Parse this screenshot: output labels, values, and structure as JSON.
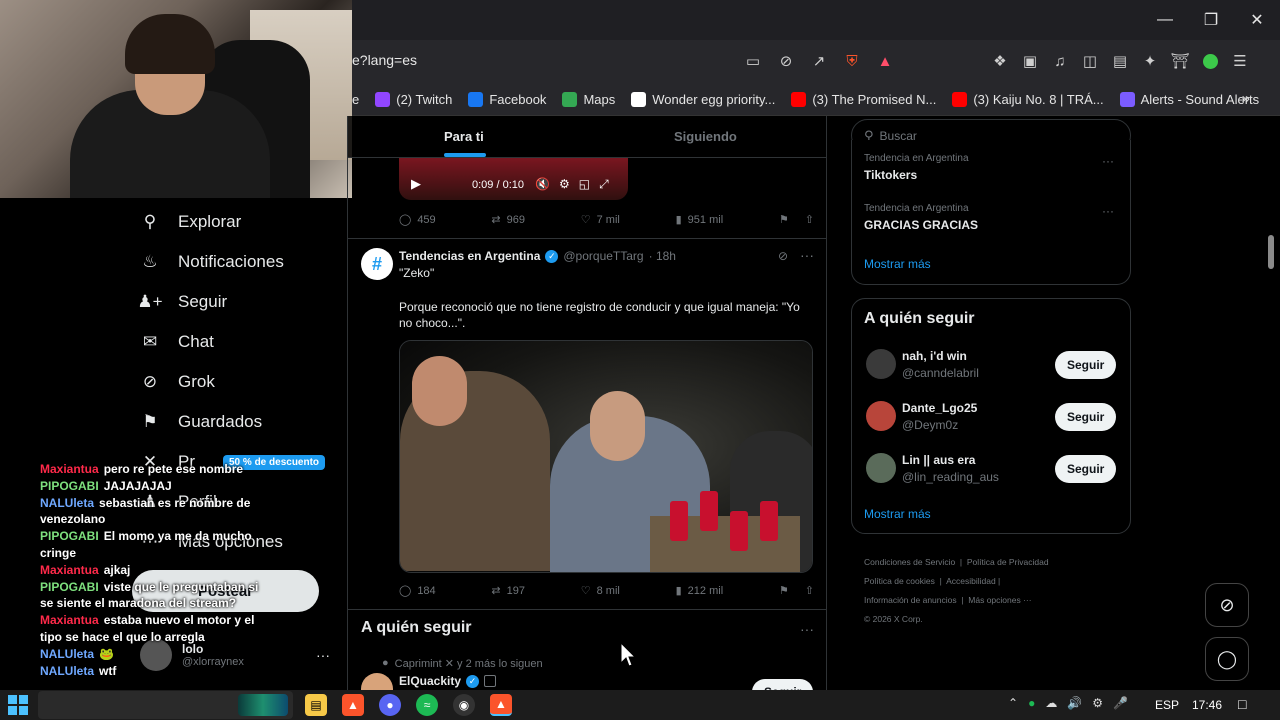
{
  "browser": {
    "url": "e?lang=es",
    "bookmarks": [
      {
        "label": "e",
        "icon": "partial-icon",
        "color": "#888888"
      },
      {
        "label": "(2) Twitch",
        "icon": "twitch-icon",
        "color": "#9146ff"
      },
      {
        "label": "Facebook",
        "icon": "facebook-icon",
        "color": "#1877f2"
      },
      {
        "label": "Maps",
        "icon": "maps-icon",
        "color": "#34a853"
      },
      {
        "label": "Wonder egg priority...",
        "icon": "google-icon",
        "color": "#ffffff"
      },
      {
        "label": "(3) The Promised N...",
        "icon": "youtube-icon",
        "color": "#ff0000"
      },
      {
        "label": "(3) Kaiju No. 8 | TRÁ...",
        "icon": "youtube-icon",
        "color": "#ff0000"
      },
      {
        "label": "Alerts - Sound Alerts",
        "icon": "soundalerts-icon",
        "color": "#7b5cff"
      }
    ]
  },
  "nav": {
    "items": [
      {
        "label": "Explorar",
        "icon": "search-icon"
      },
      {
        "label": "Notificaciones",
        "icon": "bell-icon"
      },
      {
        "label": "Seguir",
        "icon": "person-add-icon"
      },
      {
        "label": "Chat",
        "icon": "mail-icon"
      },
      {
        "label": "Grok",
        "icon": "grok-icon"
      },
      {
        "label": "Guardados",
        "icon": "bookmark-icon"
      },
      {
        "label": "Pr",
        "icon": "x-icon"
      },
      {
        "label": "Perfil",
        "icon": "person-icon"
      },
      {
        "label": "Más opciones",
        "icon": "more-icon"
      }
    ],
    "premium_badge": "50 % de descuento",
    "post_button": "Postear",
    "account_name": "lolo",
    "account_handle": "@xlorraynex"
  },
  "feed": {
    "tabs": [
      "Para ti",
      "Siguiendo"
    ],
    "video_time": "0:09 / 0:10",
    "post1_stats": {
      "replies": "459",
      "reposts": "969",
      "likes": "7 mil",
      "views": "951 mil"
    },
    "post2": {
      "author": "Tendencias en Argentina",
      "handle": "@porqueTTarg",
      "time": "· 18h",
      "quote": "\"Zeko\"",
      "body": "Porque reconoció que no tiene registro de conducir y que igual maneja: \"Yo no choco...\".",
      "stats": {
        "replies": "184",
        "reposts": "197",
        "likes": "8 mil",
        "views": "212 mil"
      }
    },
    "who_to_follow": {
      "title": "A quién seguir",
      "context": "Caprimint ✕ y 2 más lo siguen",
      "name": "ElQuackity",
      "button": "Seguir"
    }
  },
  "sidebar": {
    "search_placeholder": "Buscar",
    "trends": [
      {
        "context": "Tendencia en Argentina",
        "name": "Tiktokers"
      },
      {
        "context": "Tendencia en Argentina",
        "name": "GRACIAS GRACIAS"
      }
    ],
    "show_more": "Mostrar más",
    "follow_title": "A quién seguir",
    "suggestions": [
      {
        "name": "nah, i'd win",
        "handle": "@canndelabril",
        "button": "Seguir",
        "color": "#3a3a3a"
      },
      {
        "name": "Dante_Lgo25",
        "handle": "@Deym0z",
        "button": "Seguir",
        "color": "#b8453a"
      },
      {
        "name": "Lin || aus era",
        "handle": "@lin_reading_aus",
        "button": "Seguir",
        "color": "#5a6b5a"
      }
    ],
    "show_more2": "Mostrar más",
    "footer": {
      "line1": [
        "Condiciones de Servicio",
        "Política de Privacidad"
      ],
      "line2": [
        "Política de cookies",
        "Accesibilidad"
      ],
      "line3": [
        "Información de anuncios",
        "Más opciones ···"
      ],
      "copyright": "© 2026 X Corp."
    }
  },
  "chat": [
    {
      "nick": "Maxiantua",
      "color": "#ff2a4a",
      "msg": "pero re pete ese nombre"
    },
    {
      "nick": "PIPOGABI",
      "color": "#7ee07e",
      "msg": "JAJAJAJAJ"
    },
    {
      "nick": "NALUleta",
      "color": "#6fa8ff",
      "msg": "sebastian es re nombre de venezolano"
    },
    {
      "nick": "PIPOGABI",
      "color": "#7ee07e",
      "msg": "El momo ya me da mucho cringe"
    },
    {
      "nick": "Maxiantua",
      "color": "#ff2a4a",
      "msg": "ajkaj"
    },
    {
      "nick": "PIPOGABI",
      "color": "#7ee07e",
      "msg": "viste que le preguntaban si se siente el maradona del stream?"
    },
    {
      "nick": "Maxiantua",
      "color": "#ff2a4a",
      "msg": "estaba nuevo el motor y el tipo se hace el que lo arregla"
    },
    {
      "nick": "NALUleta",
      "color": "#6fa8ff",
      "msg": "🐸"
    },
    {
      "nick": "NALUleta",
      "color": "#6fa8ff",
      "msg": "wtf"
    }
  ],
  "taskbar": {
    "lang": "ESP",
    "time": "17:46"
  }
}
